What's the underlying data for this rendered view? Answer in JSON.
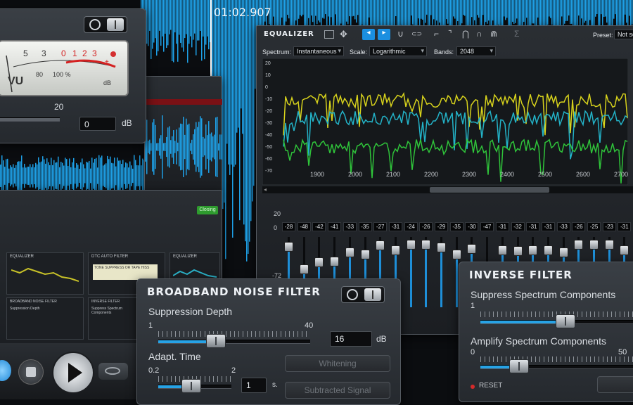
{
  "timecode": "01:02.907",
  "vu_meter": {
    "scale_labels": [
      "5",
      "3",
      "0",
      "1",
      "2",
      "3",
      "+"
    ],
    "scale_sub": [
      "80",
      "100 %"
    ],
    "vu_label": "VU",
    "db_label": "dB",
    "slider_max_label": "20",
    "value": "0",
    "unit": "dB"
  },
  "equalizer": {
    "title": "EQUALIZER",
    "preset_label": "Preset:",
    "preset_value": "Not set",
    "spectrum_label": "Spectrum:",
    "spectrum_value": "Instantaneous",
    "scale_label": "Scale:",
    "scale_value": "Logarithmic",
    "bands_label": "Bands:",
    "bands_value": "2048",
    "y_ticks": [
      "20",
      "10",
      "0",
      "-10",
      "-20",
      "-30",
      "-40",
      "-50",
      "-60",
      "-70"
    ],
    "x_ticks": [
      "1900",
      "2000",
      "2100",
      "2200",
      "2300",
      "2400",
      "2500",
      "2600",
      "2700"
    ],
    "band_values": [
      "-28",
      "-48",
      "-42",
      "-41",
      "-33",
      "-35",
      "-27",
      "-31",
      "-24",
      "-26",
      "-29",
      "-35",
      "-30",
      "-47",
      "-31",
      "-32",
      "-31",
      "-31",
      "-33",
      "-26",
      "-25",
      "-23",
      "-31"
    ],
    "band_scale": [
      "20",
      "0",
      "-72"
    ],
    "colors": {
      "yellow": "#d7d21c",
      "cyan": "#23b3c8",
      "green": "#2fc43a"
    }
  },
  "effects_rack": {
    "items": [
      {
        "title": "EQUALIZER"
      },
      {
        "title": "DTC AUTO FILTER",
        "subtitle": "TONE SUPPRESS OR TAPE HISS"
      },
      {
        "title": "EQUALIZER"
      },
      {
        "title": "BROADBAND NOISE FILTER",
        "subtitle": "Suppression Depth"
      },
      {
        "title": "INVERSE FILTER",
        "subtitle": "Suppress Spectrum Components"
      }
    ],
    "status_badge": "Closing"
  },
  "broadband_noise_filter": {
    "title": "BROADBAND NOISE FILTER",
    "suppression": {
      "label": "Suppression Depth",
      "min": "1",
      "max": "40",
      "value": "16",
      "unit": "dB",
      "level": 0.38
    },
    "adapt": {
      "label": "Adapt. Time",
      "min": "0.2",
      "max": "2",
      "value": "1",
      "unit": "s.",
      "level": 0.45
    },
    "whitening_label": "Whitening",
    "subtracted_label": "Subtracted Signal"
  },
  "inverse_filter": {
    "title": "INVERSE FILTER",
    "suppress": {
      "label": "Suppress Spectrum Components",
      "min": "1",
      "level": 0.55
    },
    "amplify": {
      "label": "Amplify Spectrum Components",
      "min": "0",
      "max": "50",
      "level": 0.25
    },
    "reset_label": "RESET"
  },
  "transport": {
    "play_icon": "play-icon",
    "stop_icon": "stop-icon",
    "eye_icon": "eye-icon"
  }
}
